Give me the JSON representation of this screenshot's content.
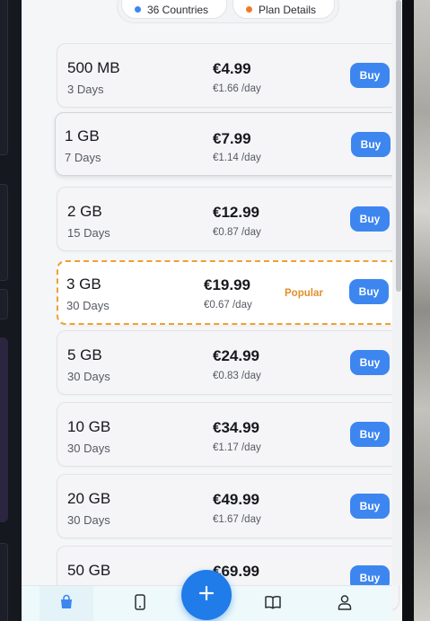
{
  "filters": [
    {
      "label": "36 Countries",
      "dot_color": "#3d86f0"
    },
    {
      "label": "Plan Details",
      "dot_color": "#f07a2a"
    }
  ],
  "plans": [
    {
      "size": "500 MB",
      "duration": "3 Days",
      "price": "€4.99",
      "per_day": "€1.66 /day",
      "badge": "",
      "buy_label": "Buy"
    },
    {
      "size": "1 GB",
      "duration": "7 Days",
      "price": "€7.99",
      "per_day": "€1.14 /day",
      "badge": "",
      "buy_label": "Buy"
    },
    {
      "size": "2 GB",
      "duration": "15 Days",
      "price": "€12.99",
      "per_day": "€0.87 /day",
      "badge": "",
      "buy_label": "Buy"
    },
    {
      "size": "3 GB",
      "duration": "30 Days",
      "price": "€19.99",
      "per_day": "€0.67 /day",
      "badge": "Popular",
      "buy_label": "Buy"
    },
    {
      "size": "5 GB",
      "duration": "30 Days",
      "price": "€24.99",
      "per_day": "€0.83 /day",
      "badge": "",
      "buy_label": "Buy"
    },
    {
      "size": "10 GB",
      "duration": "30 Days",
      "price": "€34.99",
      "per_day": "€1.17 /day",
      "badge": "",
      "buy_label": "Buy"
    },
    {
      "size": "20 GB",
      "duration": "30 Days",
      "price": "€49.99",
      "per_day": "€1.67 /day",
      "badge": "",
      "buy_label": "Buy"
    },
    {
      "size": "50 GB",
      "duration": "",
      "price": "€69.99",
      "per_day": "",
      "badge": "",
      "buy_label": "Buy"
    }
  ],
  "nav": {
    "items": [
      "shop-bag-icon",
      "phone-icon",
      "book-icon",
      "user-icon"
    ],
    "fab_icon": "plus-icon"
  },
  "colors": {
    "accent": "#3d86f0",
    "popular": "#f0a030",
    "fab": "#1f7ce8"
  }
}
